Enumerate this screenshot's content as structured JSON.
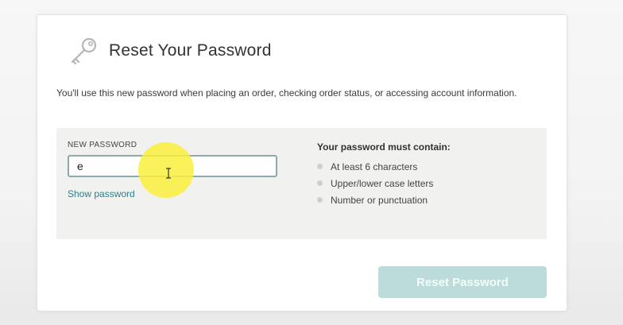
{
  "header": {
    "title": "Reset Your Password",
    "icon": "key-icon"
  },
  "intro": "You'll use this new password when placing an order, checking order status, or accessing account information.",
  "form": {
    "label": "NEW PASSWORD",
    "value": "e",
    "show_password": "Show password"
  },
  "requirements": {
    "title": "Your password must contain:",
    "items": [
      "At least 6 characters",
      "Upper/lower case letters",
      "Number or punctuation"
    ]
  },
  "actions": {
    "reset_label": "Reset Password"
  },
  "colors": {
    "accent": "#2f7f8a",
    "button_disabled": "#bcdcdb",
    "highlight": "#faee3c"
  }
}
